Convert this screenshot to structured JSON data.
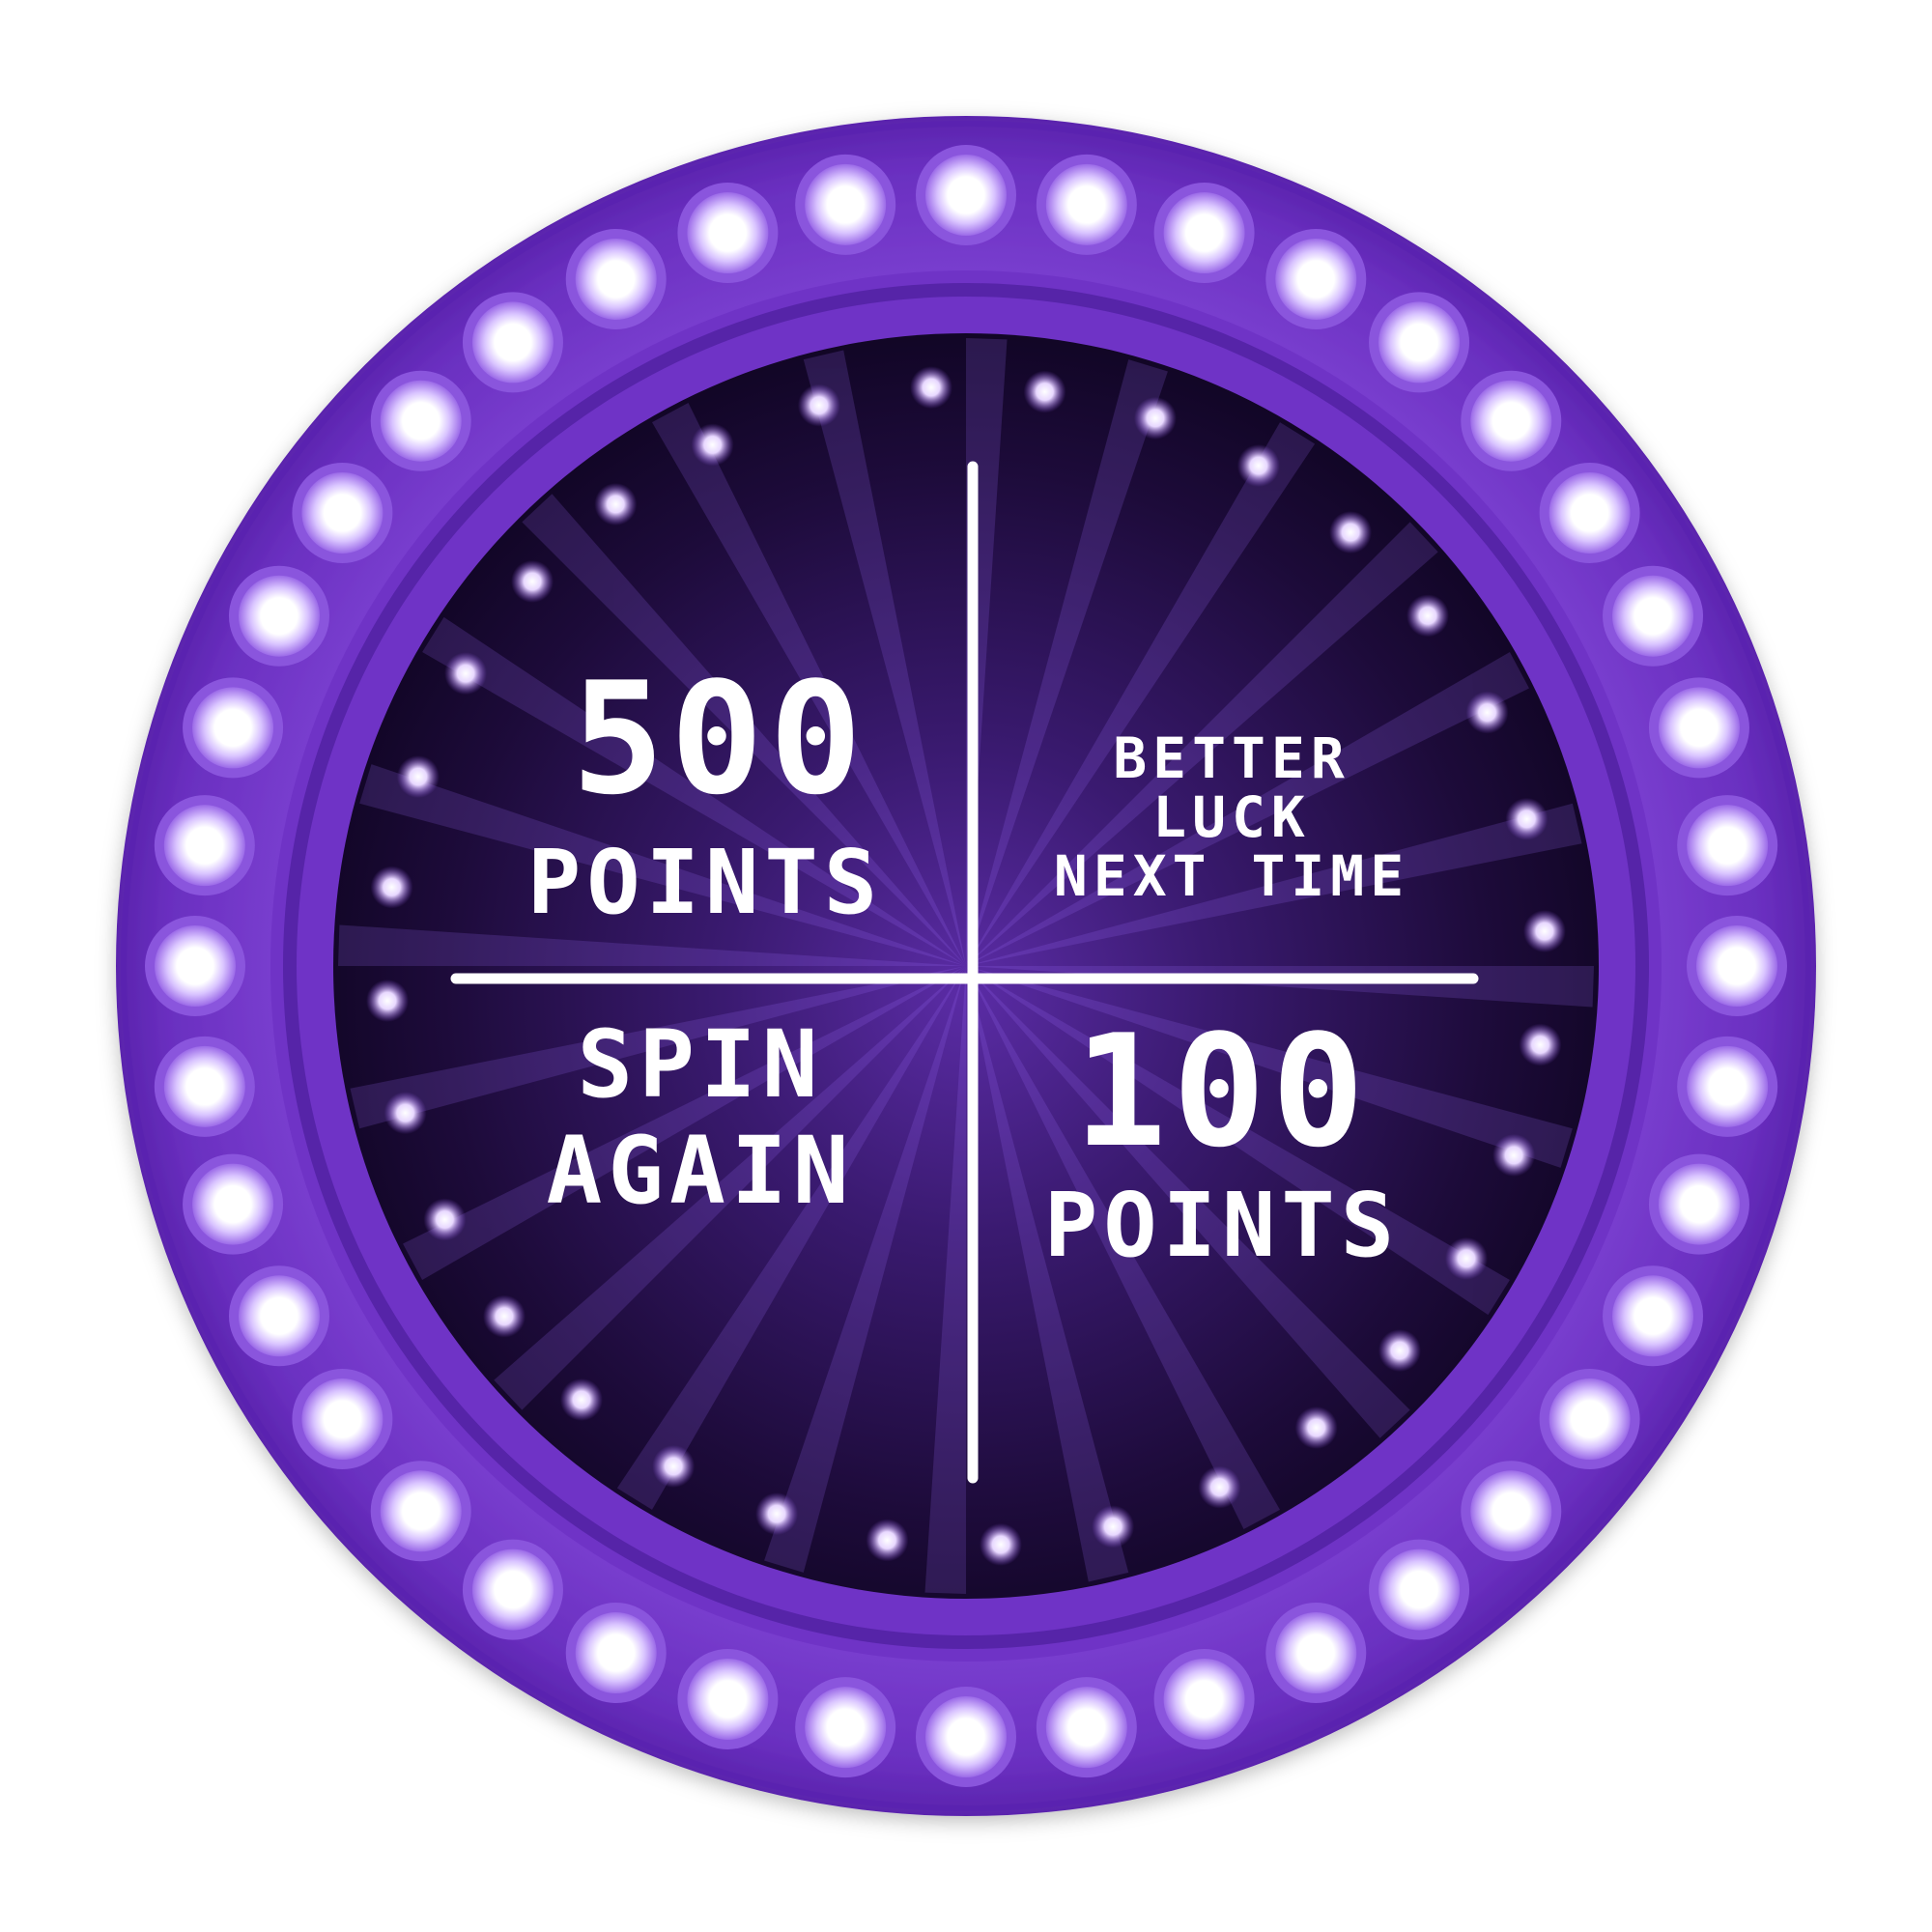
{
  "wheel": {
    "segments": [
      {
        "id": "top-left",
        "lines": [
          "500",
          "POINTS"
        ],
        "style": "big"
      },
      {
        "id": "top-right",
        "lines": [
          "BETTER",
          "LUCK",
          "NEXT TIME"
        ],
        "style": "small"
      },
      {
        "id": "bottom-left",
        "lines": [
          "SPIN",
          "AGAIN"
        ],
        "style": "medium"
      },
      {
        "id": "bottom-right",
        "lines": [
          "100",
          "POINTS"
        ],
        "style": "big"
      }
    ],
    "bulb_count": 40,
    "sparkle_count": 32
  },
  "colors": {
    "rim": "#6a2fc0",
    "rim_dark": "#4d1f99",
    "rim_light": "#8450d6",
    "center_glow": "#4e2590",
    "center_dark": "#120522",
    "text": "#ffffff",
    "bulb_glow": "#b98cff"
  }
}
